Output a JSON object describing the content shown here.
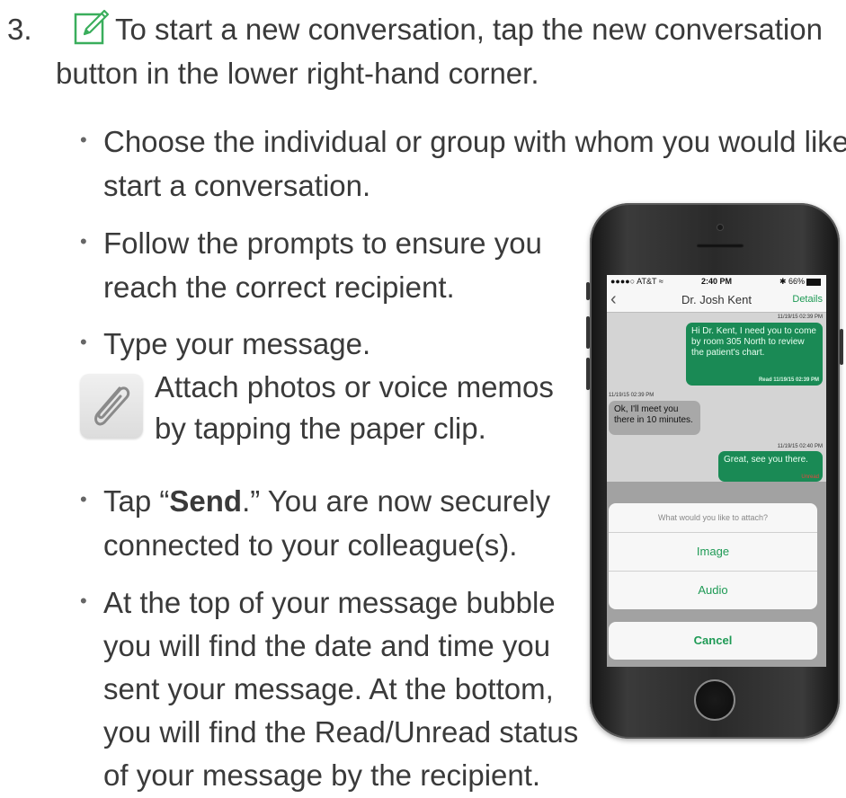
{
  "step": {
    "number": "3.",
    "line1": "To start a new conversation, tap the new conversation",
    "line2": "button in the lower right-hand corner."
  },
  "bullets": [
    {
      "lines": [
        "Choose the individual or group with whom you would like to",
        "start a conversation."
      ]
    },
    {
      "lines": [
        "Follow the prompts to ensure you",
        "reach the correct recipient."
      ]
    },
    {
      "lines": [
        "Type your message."
      ]
    },
    {
      "lines": [
        "Tap “",
        "Send",
        ".” You are now securely",
        "connected to your colleague(s)."
      ]
    },
    {
      "lines": [
        "At the top of your message bubble",
        "you will find the date and time you",
        "sent your message. At the bottom,",
        "you will find the Read/Unread status",
        "of your message by the recipient."
      ]
    }
  ],
  "attach_tip": {
    "line1": "Attach photos or voice memos",
    "line2": "by tapping the paper clip.",
    "icon": "paperclip-icon"
  },
  "icons": {
    "new_conversation": "edit-icon",
    "bullet": "•"
  },
  "colors": {
    "accent_green": "#1e9a55",
    "bubble_green": "#1a8a55",
    "unread_red": "#e8453c"
  },
  "phone": {
    "status": {
      "carrier": "●●●●○ AT&T ≈",
      "time": "2:40 PM",
      "battery": "✱ 66%"
    },
    "nav": {
      "back": "‹",
      "title": "Dr. Josh Kent",
      "details": "Details"
    },
    "messages": [
      {
        "timestamp": "11/19/15 02:39 PM",
        "text": "Hi Dr. Kent, I need you to come by room 305 North to review the patient's chart.",
        "status": "Read 11/19/15 02:39 PM",
        "direction": "out"
      },
      {
        "timestamp": "11/19/15 02:39 PM",
        "text": "Ok, I'll meet you there in 10 minutes.",
        "direction": "in"
      },
      {
        "timestamp": "11/19/15 02:40 PM",
        "text": "Great, see you there.",
        "status": "Unread",
        "direction": "out"
      }
    ],
    "sheet": {
      "prompt": "What would you like to attach?",
      "options": [
        "Image",
        "Audio"
      ],
      "cancel": "Cancel"
    }
  }
}
